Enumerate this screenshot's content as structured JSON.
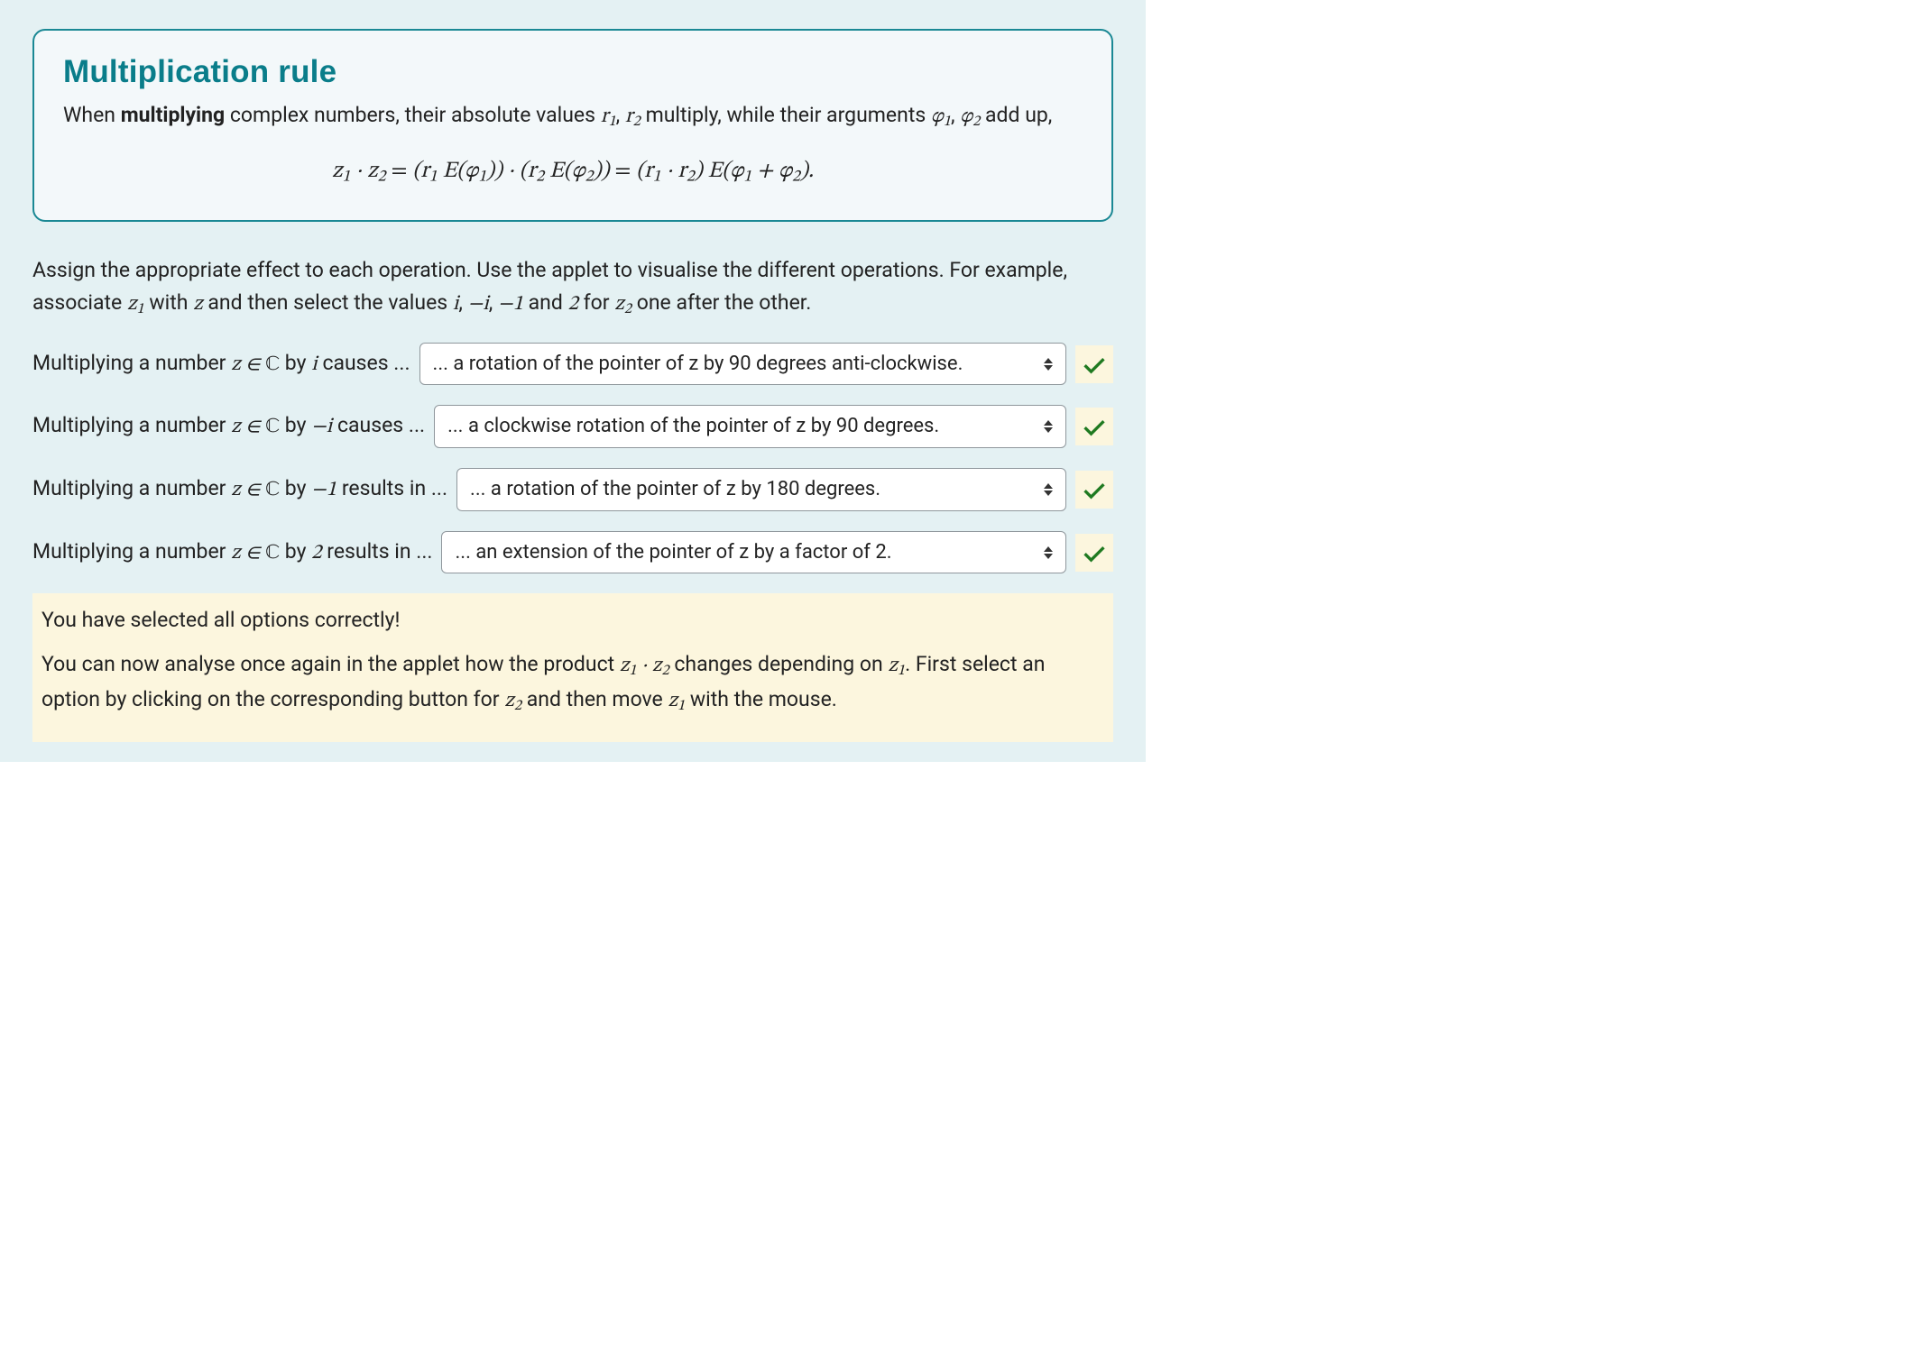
{
  "rule": {
    "title": "Multiplication rule",
    "text_before_bold": "When ",
    "bold_word": "multiplying",
    "text_after_bold_1": " complex numbers, their absolute values ",
    "r1": "r",
    "r1_sub": "1",
    "comma1": ",",
    "r2": "r",
    "r2_sub": "2",
    "text_mid": " multiply, while their arguments ",
    "phi1": "φ",
    "phi1_sub": "1",
    "comma2": ",",
    "phi2": "φ",
    "phi2_sub": "2",
    "text_after": " add up,",
    "formula_html": "z<sub>1</sub> · z<sub>2</sub> <span class='rm'>=</span> (r<sub>1</sub> E(φ<sub>1</sub>)) · (r<sub>2</sub> E(φ<sub>2</sub>)) <span class='rm'>=</span> (r<sub>1</sub> · r<sub>2</sub>) E(φ<sub>1</sub> + φ<sub>2</sub>)."
  },
  "instructions": {
    "part1": "Assign the appropriate effect to each operation. Use the applet to visualise the different operations. For example, associate ",
    "z1": "z",
    "z1_sub": "1",
    "part2": " with ",
    "z": "z",
    "part3": " and then select the values ",
    "i": "i",
    "neg_i": "−i",
    "neg_1": "−1",
    "two": "2",
    "part_sep1": ", ",
    "part_sep2": ", ",
    "part_and": " and ",
    "part4": " for ",
    "z2": "z",
    "z2_sub": "2",
    "part5": " one after the other."
  },
  "questions": [
    {
      "prompt_pre": "Multiplying a number ",
      "var": "z",
      "elem": " ∈ ",
      "set": "ℂ",
      "by_text": " by ",
      "factor": "i",
      "causes": " causes ...",
      "selected": "... a rotation of the pointer of z by 90 degrees anti-clockwise.",
      "correct": true
    },
    {
      "prompt_pre": "Multiplying a number ",
      "var": "z",
      "elem": " ∈ ",
      "set": "ℂ",
      "by_text": " by ",
      "factor": "−i",
      "causes": " causes ...",
      "selected": "... a clockwise rotation of the pointer of z by 90 degrees.",
      "correct": true
    },
    {
      "prompt_pre": "Multiplying a number ",
      "var": "z",
      "elem": " ∈ ",
      "set": "ℂ",
      "by_text": " by ",
      "factor": "−1",
      "causes": " results in ...",
      "selected": "... a rotation of the pointer of z by 180 degrees.",
      "correct": true
    },
    {
      "prompt_pre": "Multiplying a number ",
      "var": "z",
      "elem": " ∈ ",
      "set": "ℂ",
      "by_text": " by ",
      "factor": "2",
      "causes": " results in ...",
      "selected": "... an extension of the pointer of z by a factor of 2.",
      "correct": true
    }
  ],
  "feedback": {
    "line1": "You have selected all options correctly!",
    "line2_pre": "You can now analyse once again in the applet how the product ",
    "z1": "z",
    "z1_sub": "1",
    "dot": " · ",
    "z2": "z",
    "z2_sub": "2",
    "line2_mid": " changes depending on ",
    "z1b": "z",
    "z1b_sub": "1",
    "line2_after": ". First select an option by clicking on the corresponding button for ",
    "z2b": "z",
    "z2b_sub": "2",
    "line2_then": " and then move ",
    "z1c": "z",
    "z1c_sub": "1",
    "line2_end": " with the mouse."
  },
  "colors": {
    "panel_bg": "#e4f1f3",
    "box_border": "#1a8894",
    "box_bg": "#f3f8fa",
    "title_color": "#0a7d8a",
    "feedback_bg": "#fcf6de",
    "check_color": "#1f7a21"
  }
}
